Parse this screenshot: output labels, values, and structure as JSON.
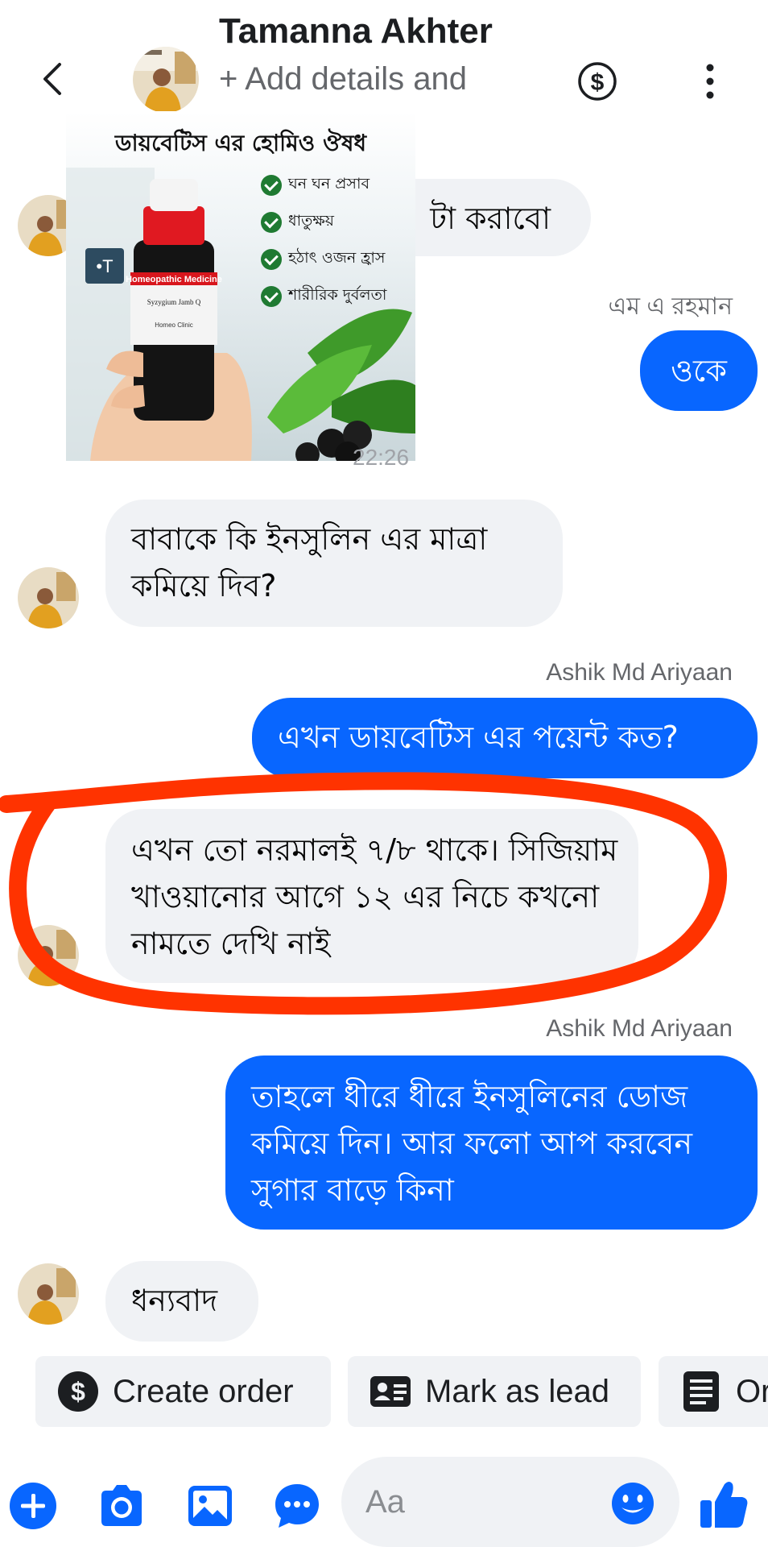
{
  "header": {
    "contact_name": "Tamanna Akhter",
    "subtitle": "+ Add details and",
    "back_icon": "chevron-left-icon",
    "payment_icon": "dollar-circle-icon",
    "menu_icon": "more-vertical-icon"
  },
  "shared_post": {
    "title": "ডায়বেটিস এর হোমিও ঔষধ",
    "benefits": [
      "ঘন ঘন প্রসাব",
      "ধাতুক্ষয়",
      "হঠাৎ ওজন হ্রাস",
      "শারীরিক দুর্বলতা"
    ],
    "bottle_label": "Homeopathic Medicine",
    "bottle_product": "Syzygium Jamb Q",
    "bottle_clinic": "Homeo Clinic",
    "timestamp": "22:26"
  },
  "messages": [
    {
      "direction": "in",
      "sender": "",
      "text": "টা করাবো"
    },
    {
      "direction": "out",
      "sender": "এম এ রহমান",
      "text": "ওকে"
    },
    {
      "direction": "in",
      "sender": "",
      "text": "বাবাকে কি ইনসুলিন এর মাত্রা কমিয়ে দিব?"
    },
    {
      "direction": "out",
      "sender": "Ashik Md Ariyaan",
      "text": "এখন ডায়বেটিস এর পয়েন্ট কত?"
    },
    {
      "direction": "in",
      "sender": "",
      "text": "এখন তো নরমালই ৭/৮ থাকে। সিজিয়াম খাওয়ানোর আগে ১২ এর নিচে কখনো নামতে দেখি নাই"
    },
    {
      "direction": "out",
      "sender": "Ashik Md Ariyaan",
      "text": "তাহলে ধীরে ধীরে ইনসুলিনের ডোজ কমিয়ে দিন। আর ফলো আপ করবেন সুগার বাড়ে কিনা"
    },
    {
      "direction": "in",
      "sender": "",
      "text": "ধন্যবাদ"
    }
  ],
  "quick_actions": [
    {
      "label": "Create order",
      "icon": "dollar-circle-icon"
    },
    {
      "label": "Mark as lead",
      "icon": "contact-card-icon"
    },
    {
      "label": "Or",
      "icon": "list-document-icon"
    }
  ],
  "composer": {
    "placeholder": "Aa",
    "icons": [
      "plus-circle-icon",
      "camera-icon",
      "image-icon",
      "chat-bubble-icon",
      "emoji-icon",
      "thumbs-up-icon"
    ]
  },
  "colors": {
    "accent": "#0866ff",
    "incoming_bubble": "#f0f2f5",
    "annotation_red": "#ff3300"
  }
}
